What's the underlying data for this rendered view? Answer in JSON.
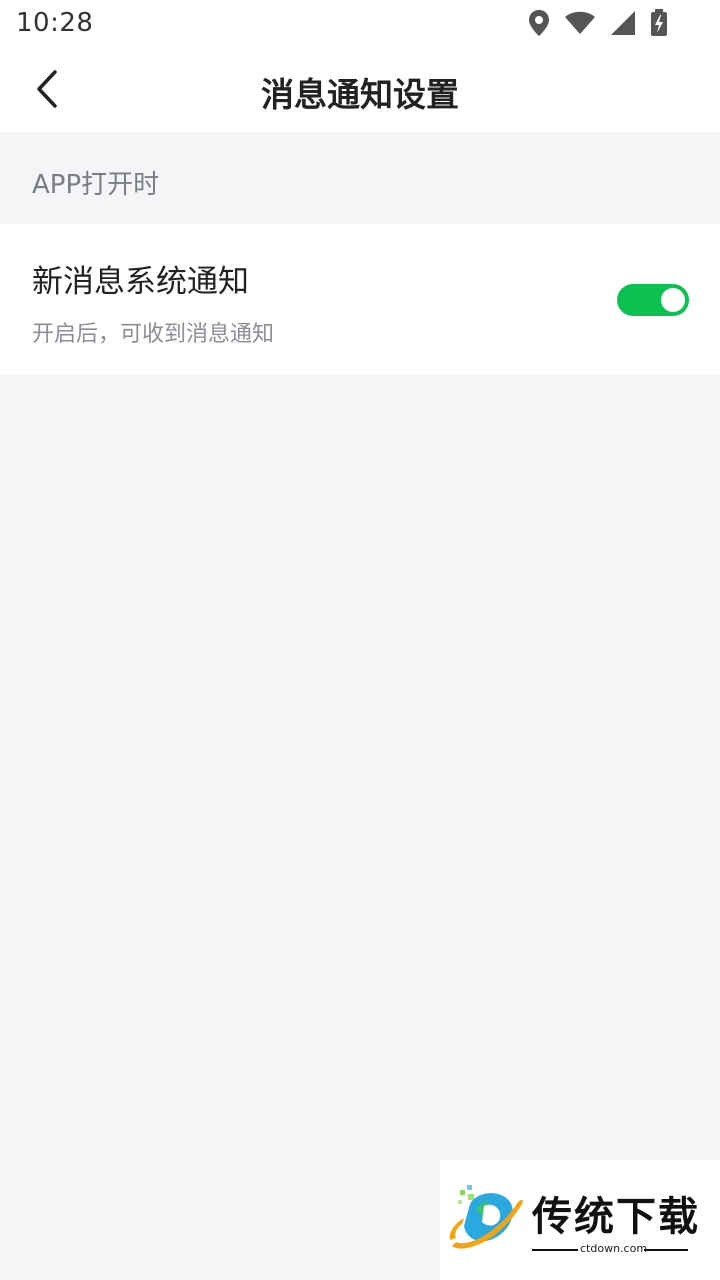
{
  "status_bar": {
    "time": "10:28",
    "icons": [
      "location-icon",
      "wifi-icon",
      "signal-icon",
      "battery-charging-icon"
    ]
  },
  "nav": {
    "back_icon": "chevron-left-icon",
    "title": "消息通知设置"
  },
  "section": {
    "header": "APP打开时"
  },
  "setting": {
    "label": "新消息系统通知",
    "description": "开启后，可收到消息通知",
    "enabled": true
  },
  "watermark": {
    "brand": "传统下载",
    "domain": "ctdown.com"
  },
  "colors": {
    "toggle_on": "#0ac152",
    "page_bg": "#f4f5f7",
    "card_bg": "#ffffff"
  }
}
